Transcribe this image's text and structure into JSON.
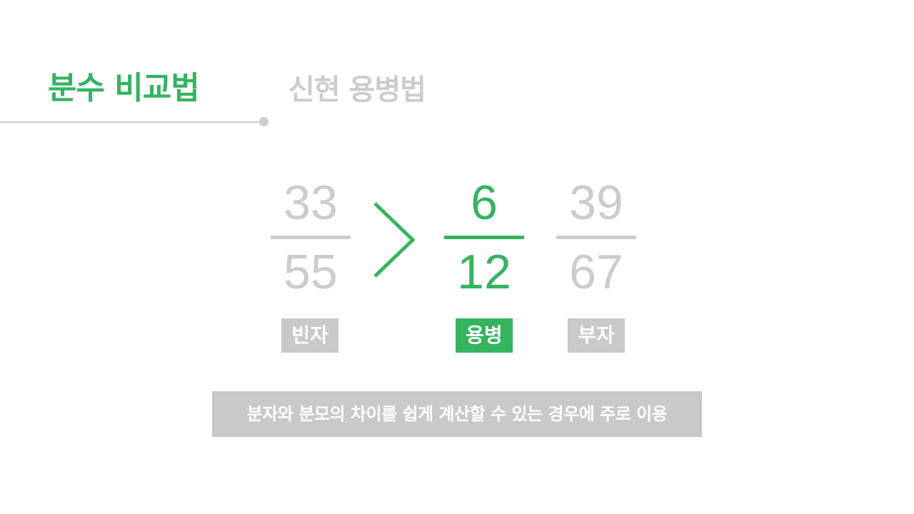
{
  "header": {
    "title": "분수 비교법",
    "subtitle": "신현 용병법"
  },
  "fractions": [
    {
      "numerator": "33",
      "denominator": "55",
      "tag": "빈자"
    },
    {
      "numerator": "6",
      "denominator": "12",
      "tag": "용병"
    },
    {
      "numerator": "39",
      "denominator": "67",
      "tag": "부자"
    }
  ],
  "comparison_symbol": "greater-than-icon",
  "note": "분자와 분모의 차이를 쉽게 계산할 수 있는 경우에 주로 이용",
  "colors": {
    "accent": "#34b45f",
    "muted": "#cccccc",
    "badge_muted": "#c9c9c9",
    "background": "#ffffff"
  }
}
